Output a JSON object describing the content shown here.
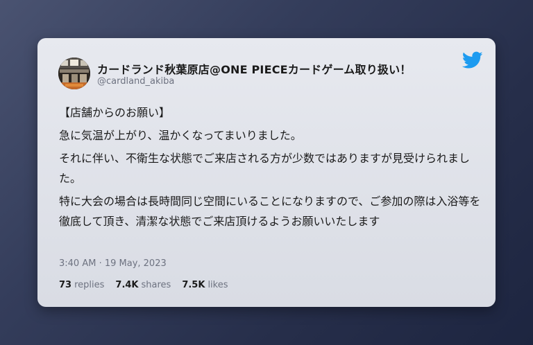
{
  "tweet": {
    "display_name": "カードランド秋葉原店@ONE PIECEカードゲーム取り扱い！",
    "handle": "@cardland_akiba",
    "body": [
      "【店舗からのお願い】",
      "急に気温が上がり、温かくなってまいりました。",
      "それに伴い、不衛生な状態でご来店される方が少数ではありますが見受けられました。",
      "特に大会の場合は長時間同じ空間にいることになりますので、ご参加の際は入浴等を徹底して頂き、清潔な状態でご来店頂けるようお願いいたします"
    ],
    "timestamp": "3:40 AM · 19 May, 2023",
    "stats": {
      "replies_count": "73",
      "replies_label": "replies",
      "shares_count": "7.4K",
      "shares_label": "shares",
      "likes_count": "7.5K",
      "likes_label": "likes"
    }
  },
  "icons": {
    "brand": "twitter-bird-icon",
    "avatar": "store-interior-photo"
  },
  "colors": {
    "twitter_blue": "#1d9bf0",
    "card_bg": "#e3e5eb",
    "text_primary": "#1a1a1a",
    "text_secondary": "#6d7280"
  }
}
